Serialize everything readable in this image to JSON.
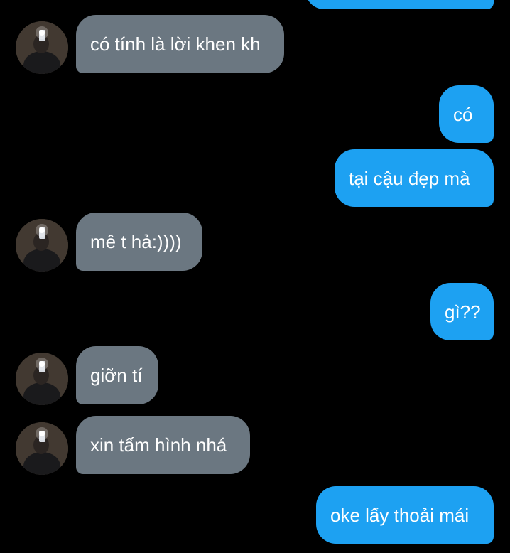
{
  "colors": {
    "background": "#000000",
    "incoming_bubble": "#6b7781",
    "outgoing_bubble": "#1da1f2",
    "text": "#ffffff"
  },
  "messages": [
    {
      "side": "outgoing",
      "text": ""
    },
    {
      "side": "incoming",
      "text": "có tính là lời khen kh"
    },
    {
      "side": "outgoing",
      "text": "có"
    },
    {
      "side": "outgoing",
      "text": "tại cậu đẹp mà"
    },
    {
      "side": "incoming",
      "text": "mê t hả:))))"
    },
    {
      "side": "outgoing",
      "text": "gì??"
    },
    {
      "side": "incoming",
      "text": "giỡn tí"
    },
    {
      "side": "incoming",
      "text": "xin tấm hình nhá"
    },
    {
      "side": "outgoing",
      "text": "oke lấy thoải mái"
    }
  ],
  "avatar_icon": "user-avatar-photo"
}
